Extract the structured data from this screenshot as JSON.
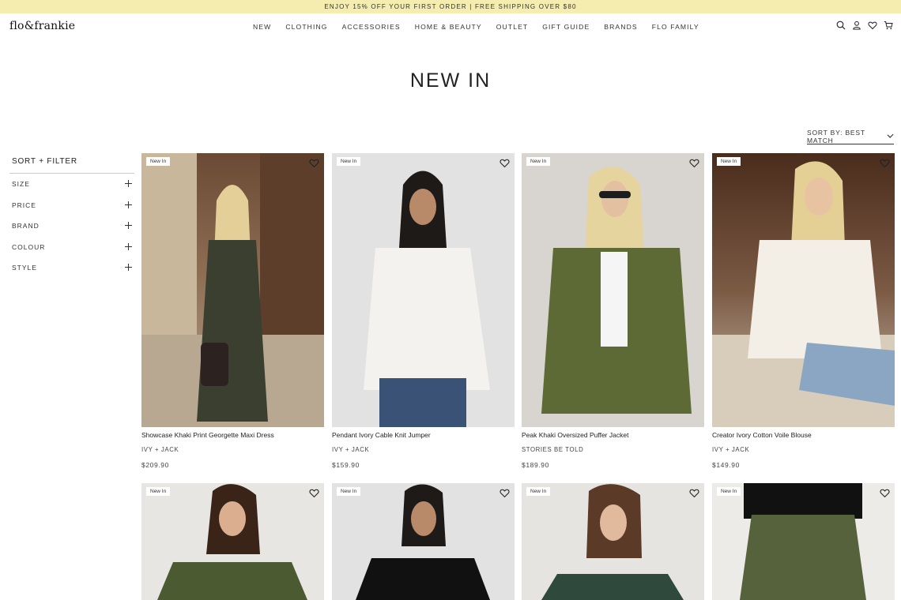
{
  "promo": {
    "text": "ENJOY 15% OFF YOUR FIRST ORDER | FREE SHIPPING OVER $80"
  },
  "header": {
    "logo": "flo&frankie",
    "nav": [
      "NEW",
      "CLOTHING",
      "ACCESSORIES",
      "HOME & BEAUTY",
      "OUTLET",
      "GIFT GUIDE",
      "BRANDS",
      "FLO FAMILY"
    ],
    "icons": [
      "search-icon",
      "account-icon",
      "wishlist-heart-icon",
      "cart-icon"
    ]
  },
  "page": {
    "title": "NEW IN"
  },
  "sort": {
    "label": "SORT BY: BEST MATCH"
  },
  "sidebar": {
    "heading": "SORT + FILTER",
    "filters": [
      "SIZE",
      "PRICE",
      "BRAND",
      "COLOUR",
      "STYLE"
    ]
  },
  "products": [
    {
      "badge": "New In",
      "name": "Showcase Khaki Print Georgette Maxi Dress",
      "brand": "IVY + JACK",
      "price": "$209.90"
    },
    {
      "badge": "New In",
      "name": "Pendant Ivory Cable Knit Jumper",
      "brand": "IVY + JACK",
      "price": "$159.90"
    },
    {
      "badge": "New In",
      "name": "Peak Khaki Oversized Puffer Jacket",
      "brand": "STORIES BE TOLD",
      "price": "$189.90"
    },
    {
      "badge": "New In",
      "name": "Creator Ivory Cotton Voile Blouse",
      "brand": "IVY + JACK",
      "price": "$149.90"
    },
    {
      "badge": "New In"
    },
    {
      "badge": "New In"
    },
    {
      "badge": "New In"
    },
    {
      "badge": "New In"
    }
  ],
  "colors": {
    "promo_bg": "#f5ecb0",
    "text": "#222222"
  }
}
